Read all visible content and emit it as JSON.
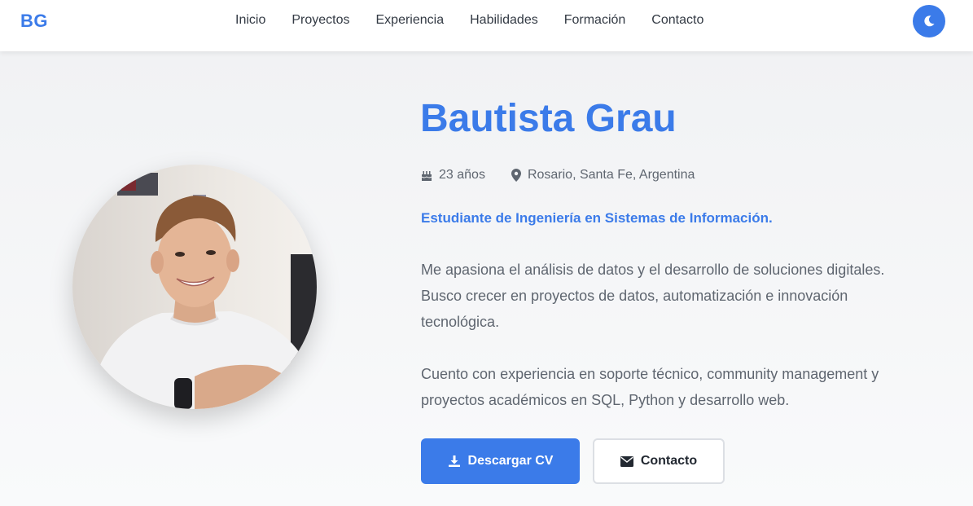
{
  "nav": {
    "logo": "BG",
    "links": [
      "Inicio",
      "Proyectos",
      "Experiencia",
      "Habilidades",
      "Formación",
      "Contacto"
    ],
    "theme_icon": "moon-icon"
  },
  "hero": {
    "name": "Bautista Grau",
    "age": "23 años",
    "location": "Rosario, Santa Fe, Argentina",
    "role": "Estudiante de Ingeniería en Sistemas de Información.",
    "paragraph1": "Me apasiona el análisis de datos y el desarrollo de soluciones digitales. Busco crecer en proyectos de datos, automatización e innovación tecnológica.",
    "paragraph2": "Cuento con experiencia en soporte técnico, community management y proyectos académicos en SQL, Python y desarrollo web.",
    "buttons": {
      "download_cv": "Descargar CV",
      "contact": "Contacto"
    }
  },
  "colors": {
    "accent": "#3b7be9",
    "text": "#5f6670",
    "heading_nav": "#333a44"
  }
}
